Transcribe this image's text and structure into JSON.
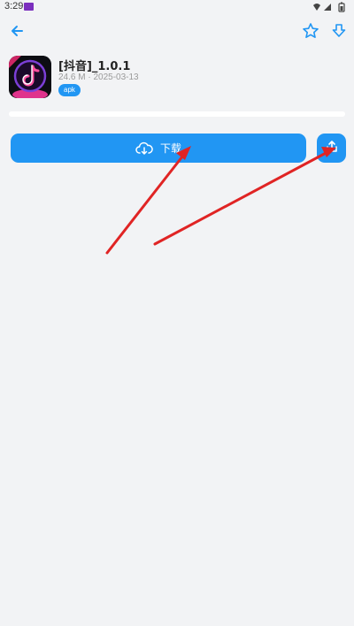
{
  "status_bar": {
    "time": "3:29",
    "icons": [
      "notification-icon",
      "wifi-icon",
      "battery-icon"
    ]
  },
  "app_bar": {
    "icons": [
      "back-arrow-icon",
      "star-icon",
      "download-arrow-icon"
    ]
  },
  "app": {
    "title": "[抖音]_1.0.1",
    "meta": "24.6 M · 2025-03-13",
    "badge": "apk",
    "icon": "tiktok-app-icon"
  },
  "download_progress": 0,
  "actions": {
    "download_label": "下载",
    "download_icon": "cloud-download-icon",
    "share_icon": "share-icon"
  },
  "colors": {
    "accent": "#2196f3",
    "background": "#f2f3f5",
    "annotation": "#e02424"
  }
}
